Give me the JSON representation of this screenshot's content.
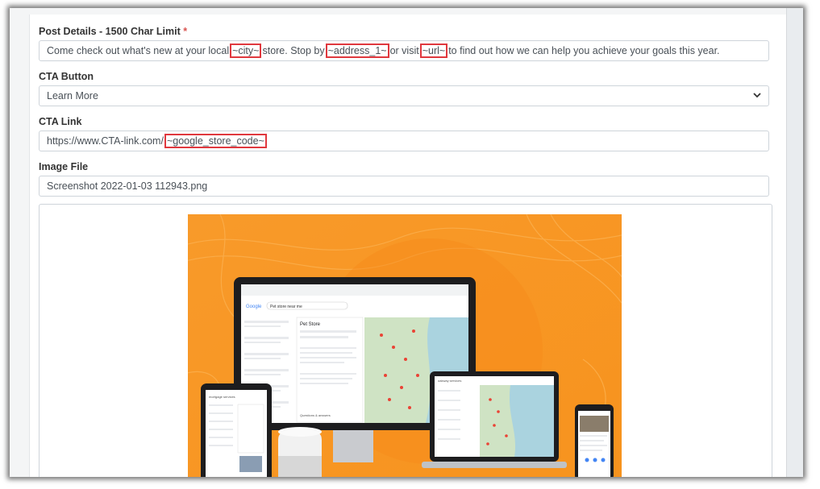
{
  "post_details": {
    "label": "Post Details - 1500 Char Limit",
    "required_mark": "*",
    "value_parts": {
      "p1": "Come check out what's new at your local",
      "t1": "~city~",
      "p2": "store. Stop by",
      "t2": "~address_1~",
      "p3": "or visit",
      "t3": "~url~",
      "p4": "to find out how we can help you achieve your goals this year."
    }
  },
  "cta_button": {
    "label": "CTA Button",
    "selected": "Learn More"
  },
  "cta_link": {
    "label": "CTA Link",
    "value_prefix": "https://www.CTA-link.com/",
    "value_token": "~google_store_code~"
  },
  "image_file": {
    "label": "Image File",
    "value": "Screenshot 2022-01-03 112943.png"
  },
  "preview": {
    "laptop_search": "Pet store near me",
    "laptop_panel_title": "Pet Store",
    "laptop_footer": "Questions & answers",
    "tablet_search": "mortgage services",
    "small_search": "oakway services",
    "google_logo": "Google",
    "colors": {
      "background_orange": "#f7941d",
      "highlight_red": "#e0383e",
      "map_green": "#cfe3c4",
      "map_water": "#aad3df"
    }
  }
}
